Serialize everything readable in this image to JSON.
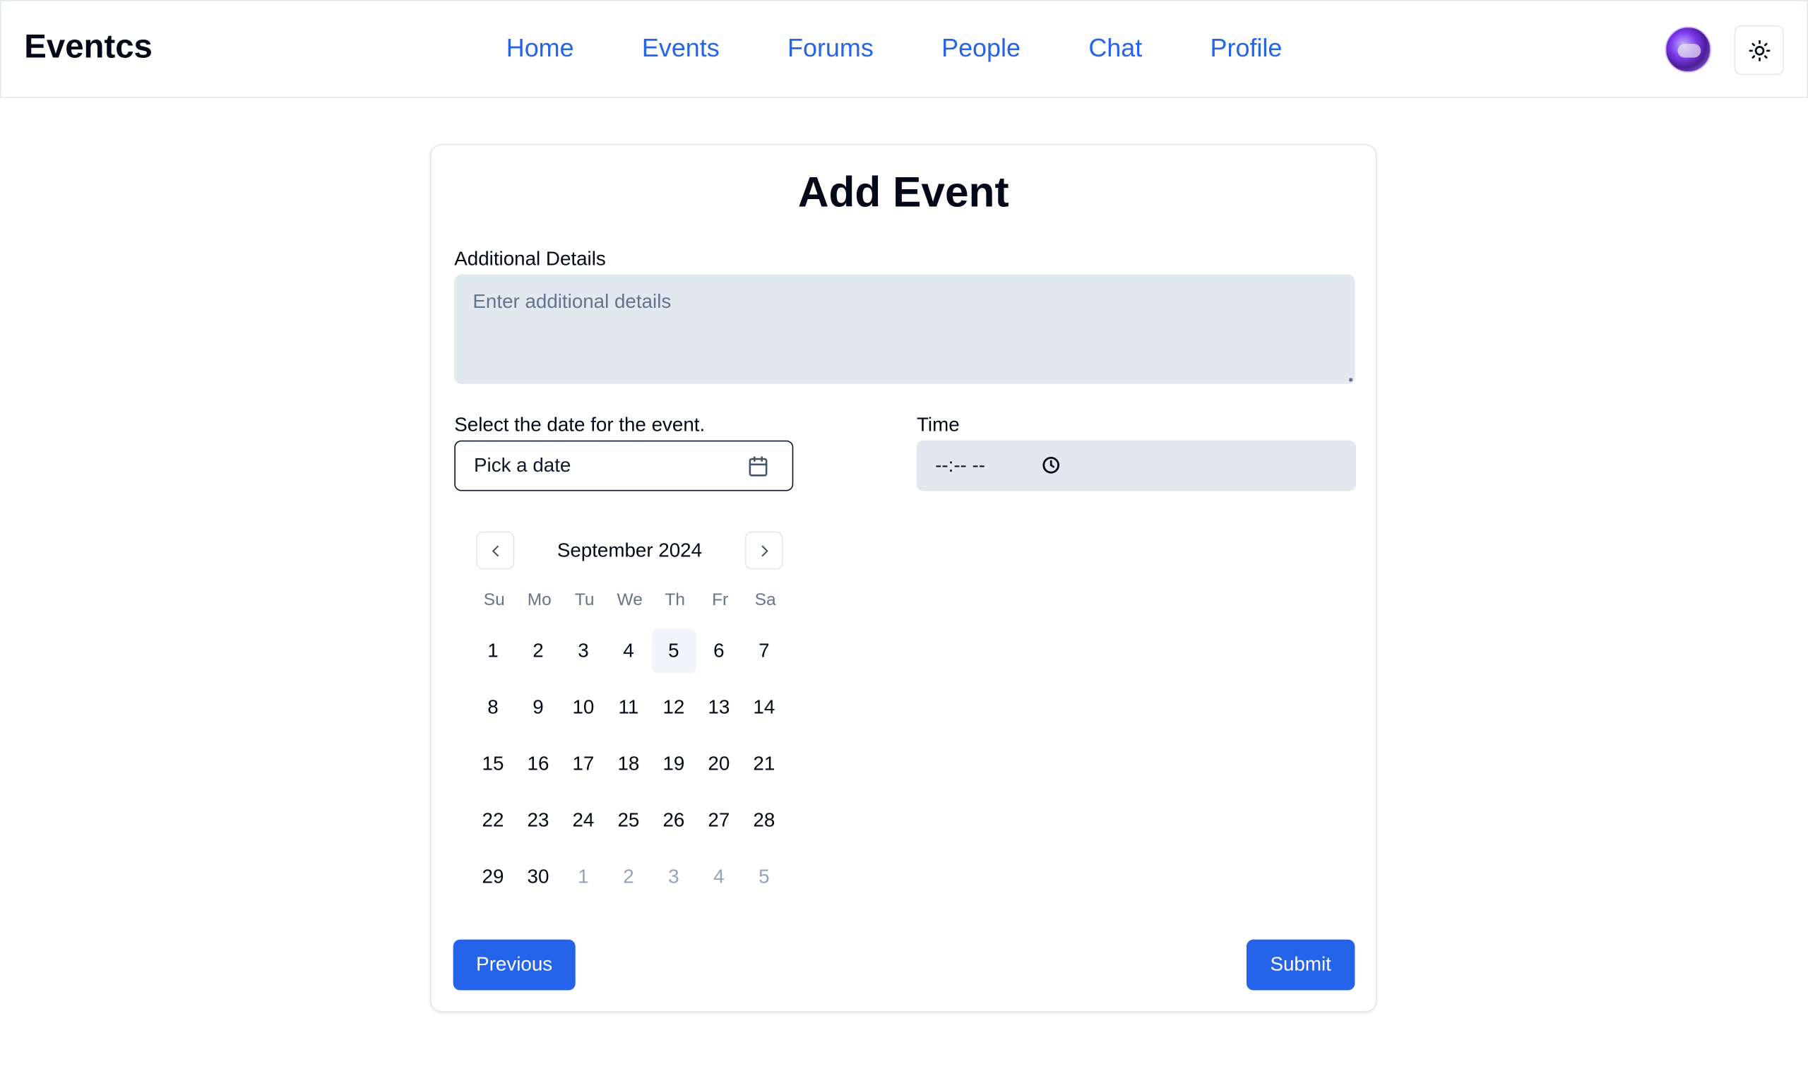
{
  "header": {
    "brand": "Eventcs",
    "nav": [
      "Home",
      "Events",
      "Forums",
      "People",
      "Chat",
      "Profile"
    ],
    "theme_icon": "sun-icon"
  },
  "form": {
    "title": "Add Event",
    "details_label": "Additional Details",
    "details_placeholder": "Enter additional details",
    "date_label": "Select the date for the event.",
    "date_button": "Pick a date",
    "time_label": "Time",
    "time_value": "--:-- --",
    "previous_button": "Previous",
    "submit_button": "Submit"
  },
  "calendar": {
    "month": "September 2024",
    "weekdays": [
      "Su",
      "Mo",
      "Tu",
      "We",
      "Th",
      "Fr",
      "Sa"
    ],
    "today": "5",
    "days": [
      {
        "d": "1"
      },
      {
        "d": "2"
      },
      {
        "d": "3"
      },
      {
        "d": "4"
      },
      {
        "d": "5",
        "today": true
      },
      {
        "d": "6"
      },
      {
        "d": "7"
      },
      {
        "d": "8"
      },
      {
        "d": "9"
      },
      {
        "d": "10"
      },
      {
        "d": "11"
      },
      {
        "d": "12"
      },
      {
        "d": "13"
      },
      {
        "d": "14"
      },
      {
        "d": "15"
      },
      {
        "d": "16"
      },
      {
        "d": "17"
      },
      {
        "d": "18"
      },
      {
        "d": "19"
      },
      {
        "d": "20"
      },
      {
        "d": "21"
      },
      {
        "d": "22"
      },
      {
        "d": "23"
      },
      {
        "d": "24"
      },
      {
        "d": "25"
      },
      {
        "d": "26"
      },
      {
        "d": "27"
      },
      {
        "d": "28"
      },
      {
        "d": "29"
      },
      {
        "d": "30"
      },
      {
        "d": "1",
        "outside": true
      },
      {
        "d": "2",
        "outside": true
      },
      {
        "d": "3",
        "outside": true
      },
      {
        "d": "4",
        "outside": true
      },
      {
        "d": "5",
        "outside": true
      }
    ]
  },
  "colors": {
    "accent": "#2563eb",
    "input_bg": "#e2e8f0",
    "muted_text": "#64748b"
  }
}
